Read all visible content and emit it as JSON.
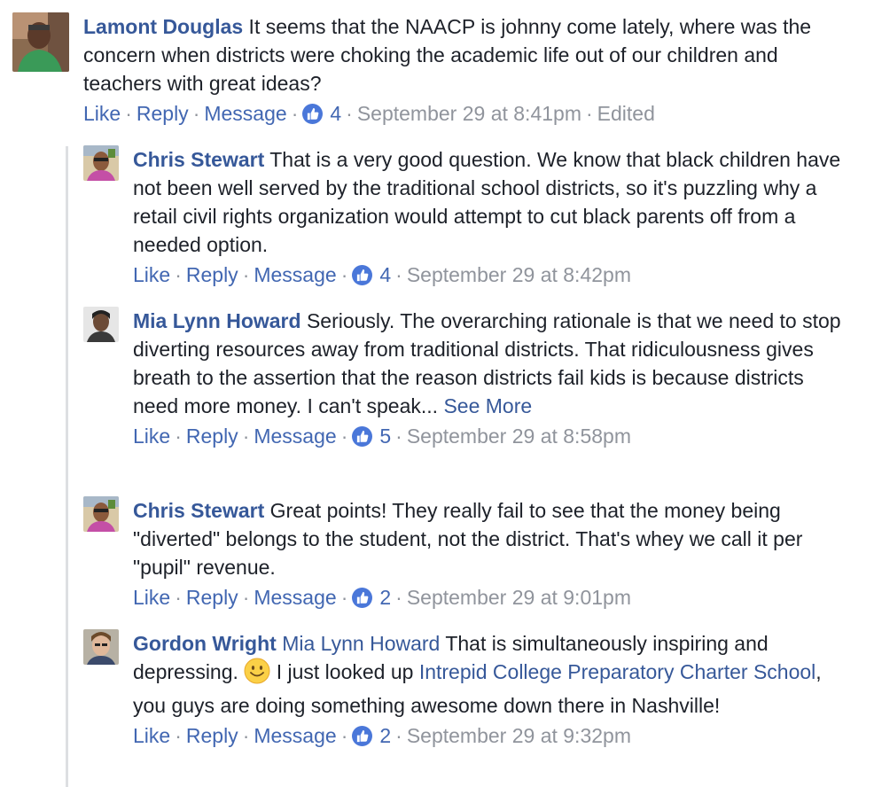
{
  "common": {
    "like_label": "Like",
    "reply_label": "Reply",
    "message_label": "Message",
    "separator": "·",
    "like_icon": "thumbs-up-icon"
  },
  "colors": {
    "name_link": "#365899",
    "text": "#1d2129",
    "meta": "#90949c",
    "like_badge": "#4a77d9",
    "rail": "#dddfe2"
  },
  "comments": [
    {
      "author": "Lamont Douglas",
      "text": " It seems that the NAACP is johnny come lately, where was the concern when districts were choking the academic life out of our children and teachers with great ideas?",
      "likes": "4",
      "timestamp": "September 29 at 8:41pm",
      "edited": "Edited"
    },
    {
      "author": "Chris Stewart",
      "text": " That is a very good question. We know that black children have not been well served by the traditional school districts, so it's puzzling why a retail civil rights organization would attempt to cut black parents off from a needed option.",
      "likes": "4",
      "timestamp": "September 29 at 8:42pm"
    },
    {
      "author": "Mia Lynn Howard",
      "text": " Seriously. The overarching rationale is that we need to stop diverting resources away from traditional districts. That ridiculousness gives breath to the assertion that the reason districts fail kids is because districts need more money. I can't speak... ",
      "see_more": "See More",
      "likes": "5",
      "timestamp": "September 29 at 8:58pm"
    },
    {
      "author": "Chris Stewart",
      "text": " Great points! They really fail to see that the money being \"diverted\" belongs to the student, not the district. That's whey we call it per \"pupil\" revenue.",
      "likes": "2",
      "timestamp": "September 29 at 9:01pm"
    },
    {
      "author": "Gordon Wright",
      "mention": "Mia Lynn Howard",
      "text_before_emoji": " That is simultaneously inspiring and depressing. ",
      "emoji": "smiley-emoji",
      "text_after_emoji": " I just looked up ",
      "page_link": "Intrepid College Preparatory Charter School",
      "text_end": ", you guys are doing something awesome down there in Nashville!",
      "likes": "2",
      "timestamp": "September 29 at 9:32pm"
    }
  ]
}
